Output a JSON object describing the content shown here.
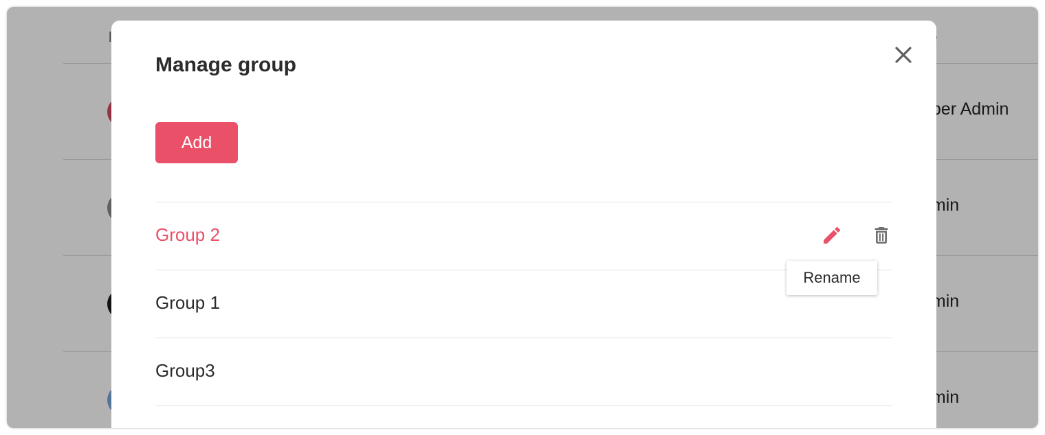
{
  "background": {
    "header_partial": "l",
    "role_header_partial": "le",
    "rows": [
      {
        "role_partial": "uper Admin",
        "avatar_color": "#d24a60"
      },
      {
        "role_partial": "dmin",
        "avatar_color": "#8a8a8a"
      },
      {
        "role_partial": "dmin",
        "avatar_color": "#1a1a1a"
      },
      {
        "role_partial": "dmin",
        "avatar_color": "#7aa6d8"
      }
    ]
  },
  "modal": {
    "title": "Manage group",
    "add_label": "Add",
    "groups": [
      {
        "name": "Group 2",
        "active": true
      },
      {
        "name": "Group 1",
        "active": false
      },
      {
        "name": "Group3",
        "active": false
      }
    ],
    "tooltip": "Rename",
    "colors": {
      "accent": "#ea5068",
      "text": "#2b2b2b",
      "icon_gray": "#707070"
    },
    "icons": {
      "close": "close-icon",
      "edit": "pencil-icon",
      "delete": "trash-icon"
    }
  }
}
